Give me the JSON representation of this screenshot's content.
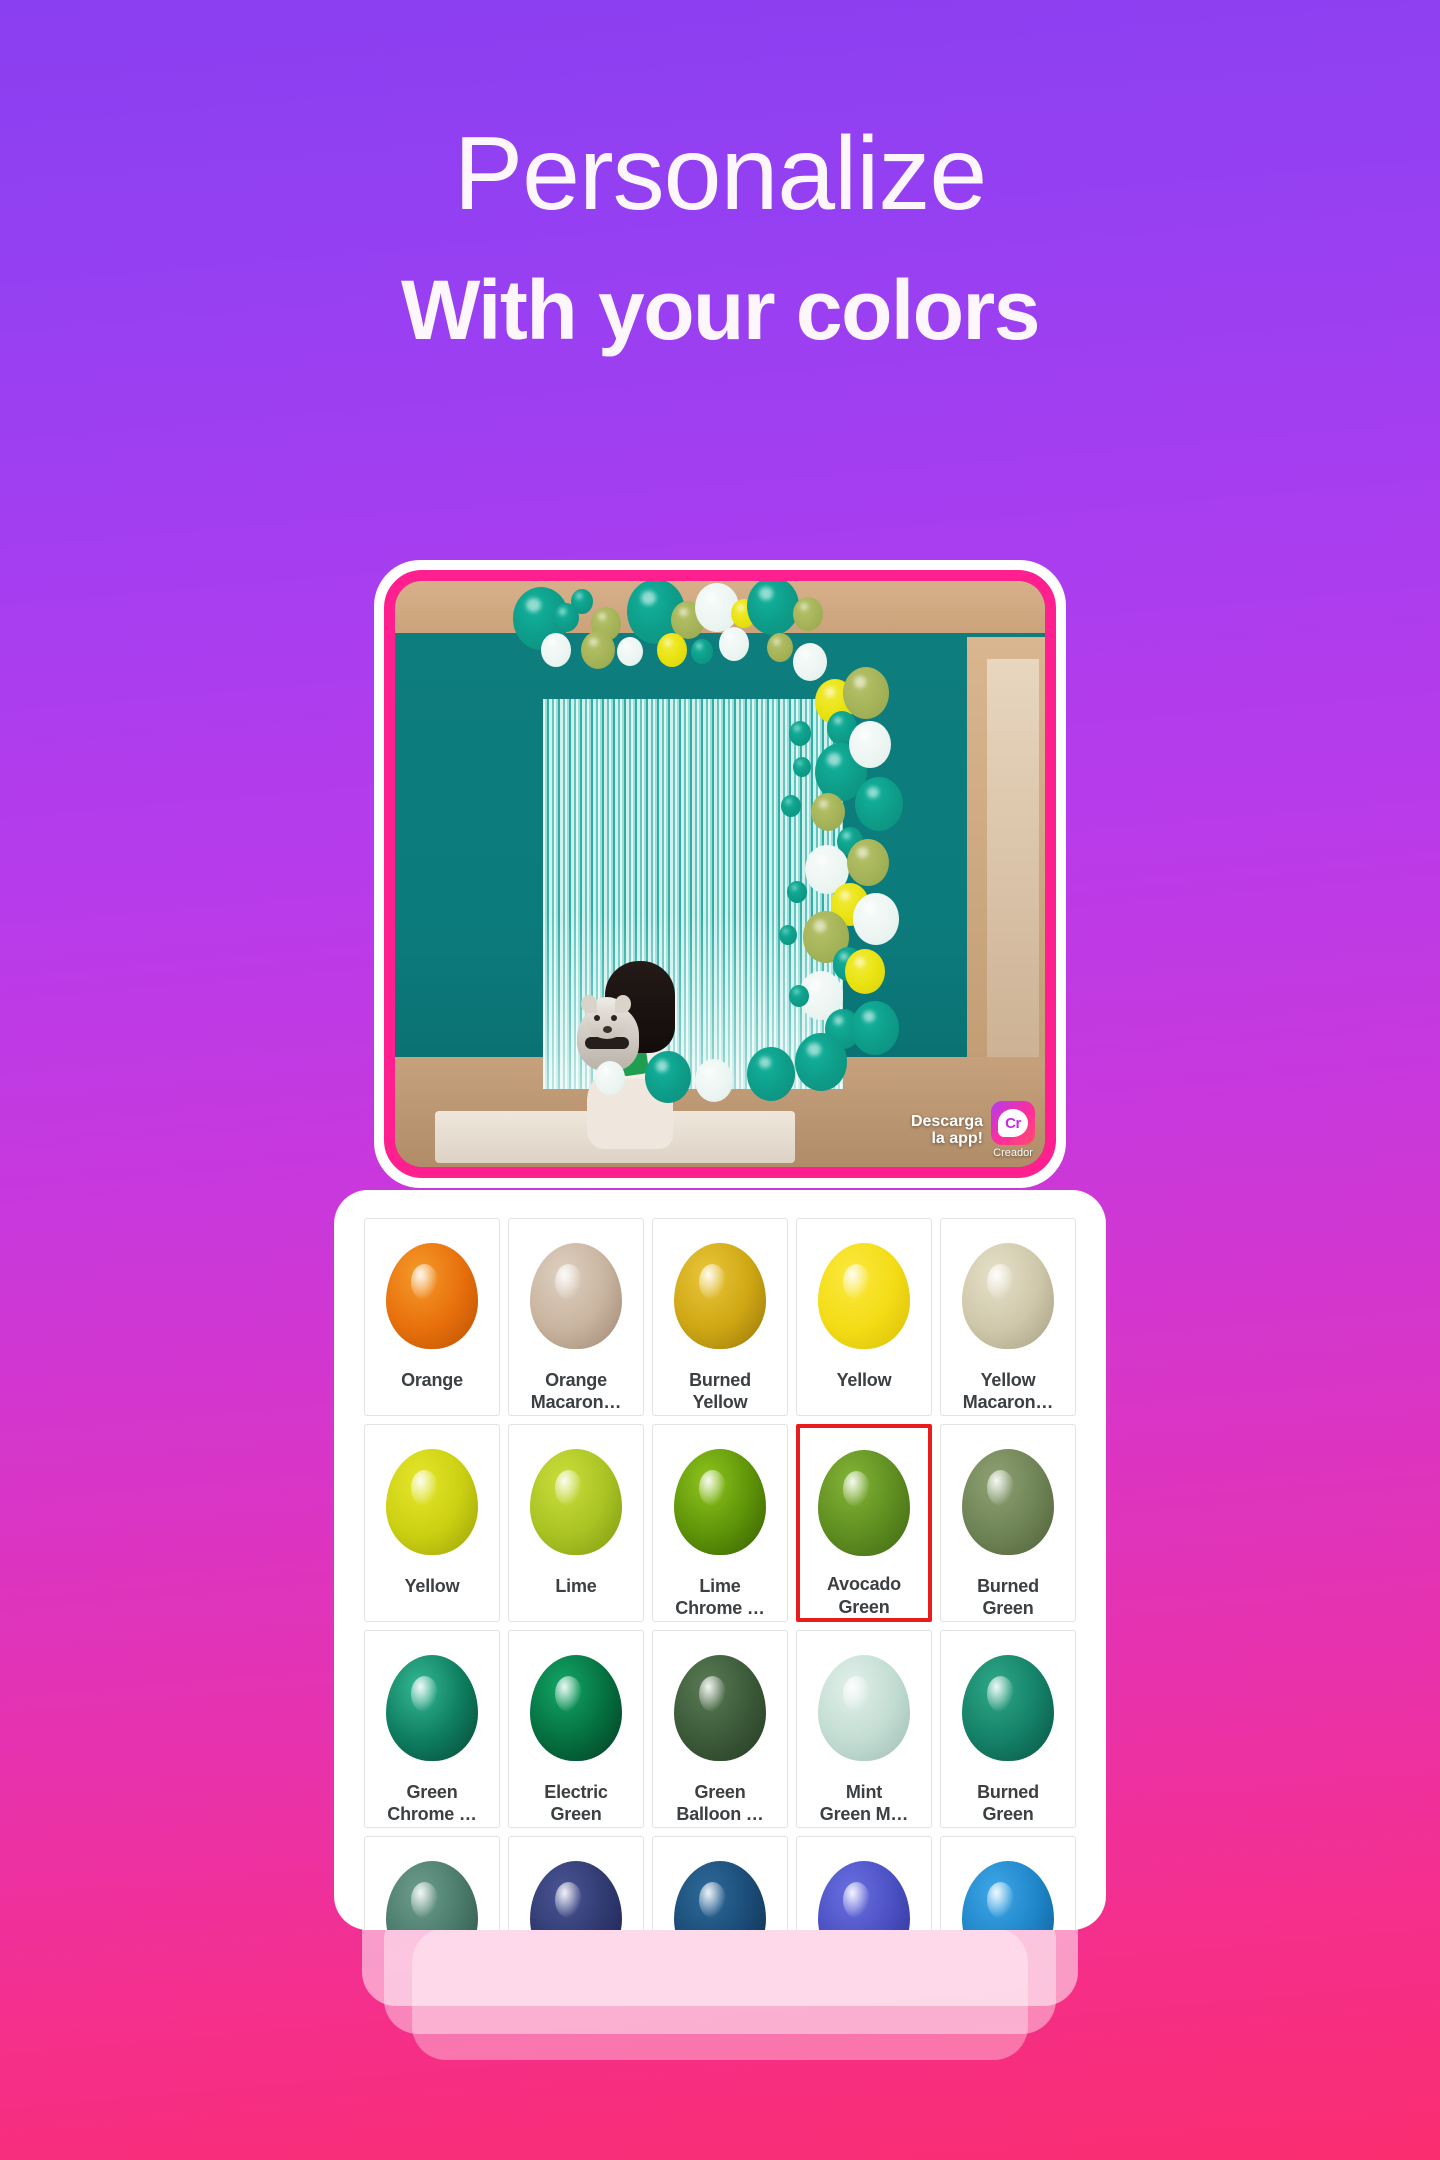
{
  "heading": {
    "line1": "Personalize",
    "line2": "With your colors"
  },
  "colors": {
    "background_start": "#8a3ff0",
    "background_end": "#fa2d70",
    "phone_frame": "#ff1f8f",
    "phone_body": "#ffffff",
    "selection_outline": "#e81c1c",
    "sheet_background": "#ffffff",
    "label_text": "#3c4043"
  },
  "phone": {
    "photo": {
      "wall_color": "#0c7b7c",
      "fringe_curtain": true,
      "subject": "woman holding small dog",
      "watermark": {
        "line1": "Descarga",
        "line2": "la app!",
        "badge_text": "Cr",
        "badge_caption": "Creador"
      }
    }
  },
  "picker": {
    "columns": 5,
    "selected_index": 8,
    "items": [
      {
        "label": "Orange",
        "c1": "#f59a2a",
        "c2": "#e8700c",
        "c3": "#b84f03"
      },
      {
        "label": "Orange\nMacaron…",
        "c1": "#ded0c1",
        "c2": "#c9b49f",
        "c3": "#9c8673"
      },
      {
        "label": "Burned\nYellow",
        "c1": "#e8c63a",
        "c2": "#cfa714",
        "c3": "#96750a"
      },
      {
        "label": "Yellow",
        "c1": "#fbe93e",
        "c2": "#f4dc16",
        "c3": "#d6bd08"
      },
      {
        "label": "Yellow\nMacaron…",
        "c1": "#e6e0c9",
        "c2": "#cfc8ab",
        "c3": "#a69d81"
      },
      {
        "label": "Yellow",
        "c1": "#e4e62a",
        "c2": "#ccd012",
        "c3": "#97a008"
      },
      {
        "label": "Lime",
        "c1": "#cade3a",
        "c2": "#aac424",
        "c3": "#7d9611"
      },
      {
        "label": "Lime\nChrome …",
        "c1": "#8fc41e",
        "c2": "#5e9408",
        "c3": "#355c03"
      },
      {
        "label": "Avocado\nGreen",
        "c1": "#84b436",
        "c2": "#5f8e21",
        "c3": "#3f6712"
      },
      {
        "label": "Burned\nGreen",
        "c1": "#8ea173",
        "c2": "#6f8456",
        "c3": "#4e6038"
      },
      {
        "label": "Green\nChrome …",
        "c1": "#34b894",
        "c2": "#0e7d5f",
        "c3": "#064534"
      },
      {
        "label": "Electric\nGreen",
        "c1": "#13a667",
        "c2": "#057040",
        "c3": "#023a22"
      },
      {
        "label": "Green\nBalloon …",
        "c1": "#5a7a55",
        "c2": "#3b5a38",
        "c3": "#243a22"
      },
      {
        "label": "Mint\nGreen M…",
        "c1": "#e1f0ea",
        "c2": "#c3ddd3",
        "c3": "#9ebdb2"
      },
      {
        "label": "Burned\nGreen",
        "c1": "#2fa888",
        "c2": "#148168",
        "c3": "#0a5241"
      },
      {
        "label": "",
        "c1": "#6d9e8d",
        "c2": "#4a7a69",
        "c3": "#2e5246"
      },
      {
        "label": "",
        "c1": "#4a5494",
        "c2": "#303a70",
        "c3": "#1c2350"
      },
      {
        "label": "",
        "c1": "#2d6a9a",
        "c2": "#1b4b76",
        "c3": "#0f2e4c"
      },
      {
        "label": "",
        "c1": "#6a6fe0",
        "c2": "#4a4fc2",
        "c3": "#2f3390"
      },
      {
        "label": "",
        "c1": "#3fa8e8",
        "c2": "#1e85c8",
        "c3": "#0f5b92"
      }
    ]
  }
}
